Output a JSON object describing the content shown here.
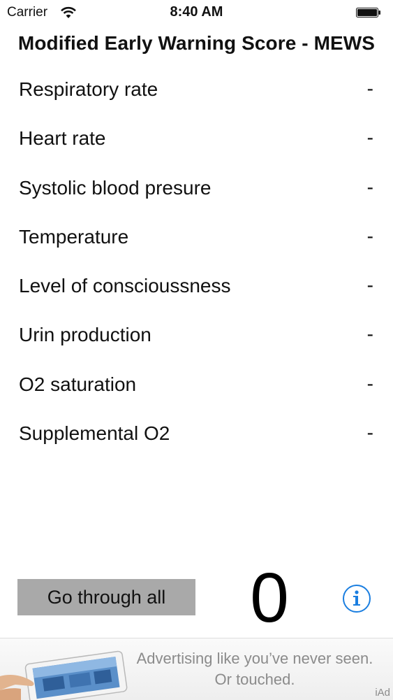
{
  "status_bar": {
    "carrier": "Carrier",
    "time": "8:40 AM",
    "icons": [
      "wifi-icon",
      "battery-icon"
    ]
  },
  "title": "Modified Early Warning Score - MEWS",
  "parameters": [
    {
      "label": "Respiratory rate",
      "value": "-"
    },
    {
      "label": "Heart rate",
      "value": "-"
    },
    {
      "label": "Systolic blood presure",
      "value": "-"
    },
    {
      "label": "Temperature",
      "value": "-"
    },
    {
      "label": "Level of conscioussness",
      "value": "-"
    },
    {
      "label": "Urin production",
      "value": "-"
    },
    {
      "label": "O2 saturation",
      "value": "-"
    },
    {
      "label": "Supplemental O2",
      "value": "-"
    }
  ],
  "controls": {
    "go_through_all_label": "Go through all",
    "score": "0",
    "info_icon": "info-icon",
    "button_color": "#a9a9a9",
    "info_color": "#1a7ee0"
  },
  "ad": {
    "line1": "Advertising like you’ve never seen.",
    "line2": "Or touched.",
    "brand": "iAd",
    "image": "tablet-ad-image"
  }
}
